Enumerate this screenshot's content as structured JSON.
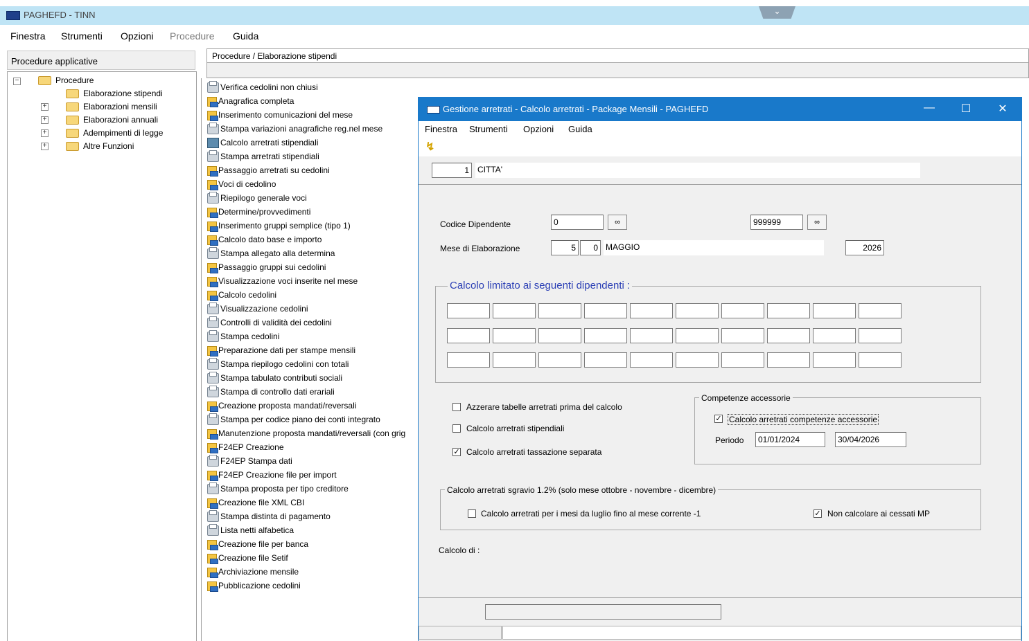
{
  "window": {
    "title": "PAGHEFD - TINN"
  },
  "menubar": [
    {
      "label": "Finestra"
    },
    {
      "label": "Strumenti"
    },
    {
      "label": "Opzioni"
    },
    {
      "label": "Procedure"
    },
    {
      "label": "Guida"
    }
  ],
  "left_panel": {
    "header": "Procedure applicative",
    "root": "Procedure",
    "items": [
      "Elaborazione stipendi",
      "Elaborazioni mensili",
      "Elaborazioni annuali",
      "Adempimenti di legge",
      "Altre Funzioni"
    ]
  },
  "center": {
    "breadcrumb": "Procedure / Elaborazione stipendi",
    "procedures": [
      {
        "label": "Verifica cedolini non chiusi",
        "icon": "print"
      },
      {
        "label": "Anagrafica completa",
        "icon": "doc"
      },
      {
        "label": "Inserimento comunicazioni del mese",
        "icon": "doc"
      },
      {
        "label": "Stampa variazioni anagrafiche reg.nel mese",
        "icon": "print"
      },
      {
        "label": "Calcolo arretrati stipendiali",
        "icon": "calc"
      },
      {
        "label": "Stampa arretrati stipendiali",
        "icon": "print"
      },
      {
        "label": "Passaggio arretrati su cedolini",
        "icon": "doc"
      },
      {
        "label": "Voci di cedolino",
        "icon": "doc"
      },
      {
        "label": "Riepilogo generale voci",
        "icon": "print"
      },
      {
        "label": "Determine/provvedimenti",
        "icon": "doc"
      },
      {
        "label": "Inserimento gruppi semplice (tipo 1)",
        "icon": "doc"
      },
      {
        "label": "Calcolo dato base e importo",
        "icon": "doc"
      },
      {
        "label": "Stampa allegato alla determina",
        "icon": "print"
      },
      {
        "label": "Passaggio gruppi sui cedolini",
        "icon": "doc"
      },
      {
        "label": "Visualizzazione voci inserite nel mese",
        "icon": "doc"
      },
      {
        "label": "Calcolo cedolini",
        "icon": "doc"
      },
      {
        "label": "Visualizzazione cedolini",
        "icon": "print"
      },
      {
        "label": "Controlli di validità dei cedolini",
        "icon": "print"
      },
      {
        "label": "Stampa cedolini",
        "icon": "print"
      },
      {
        "label": "Preparazione dati per stampe mensili",
        "icon": "doc"
      },
      {
        "label": "Stampa riepilogo cedolini con totali",
        "icon": "print"
      },
      {
        "label": "Stampa tabulato contributi sociali",
        "icon": "print"
      },
      {
        "label": "Stampa di controllo dati erariali",
        "icon": "print"
      },
      {
        "label": "Creazione proposta mandati/reversali",
        "icon": "doc"
      },
      {
        "label": "Stampa per codice piano dei conti integrato",
        "icon": "print"
      },
      {
        "label": "Manutenzione proposta mandati/reversali (con grig",
        "icon": "doc"
      },
      {
        "label": "F24EP Creazione",
        "icon": "doc"
      },
      {
        "label": "F24EP Stampa dati",
        "icon": "print"
      },
      {
        "label": "F24EP Creazione file per import",
        "icon": "doc"
      },
      {
        "label": "Stampa proposta per tipo creditore",
        "icon": "print"
      },
      {
        "label": "Creazione file XML CBI",
        "icon": "doc"
      },
      {
        "label": "Stampa distinta di pagamento",
        "icon": "print"
      },
      {
        "label": "Lista netti alfabetica",
        "icon": "print"
      },
      {
        "label": "Creazione file per banca",
        "icon": "doc"
      },
      {
        "label": "Creazione file Setif",
        "icon": "doc"
      },
      {
        "label": "Archiviazione mensile",
        "icon": "doc"
      },
      {
        "label": "Pubblicazione cedolini",
        "icon": "doc"
      }
    ]
  },
  "dialog": {
    "title": "Gestione arretrati - Calcolo arretrati  - Package Mensili - PAGHEFD",
    "menu": [
      "Finestra",
      "Strumenti",
      "Opzioni",
      "Guida"
    ],
    "ente_code": "1",
    "ente_name": "CITTA'",
    "codice_dipendente_label": "Codice Dipendente",
    "codice_da": "0",
    "codice_a": "999999",
    "mese_label": "Mese di Elaborazione",
    "mese_num": "5",
    "mese_sub": "0",
    "mese_nome": "MAGGIO",
    "anno": "2026",
    "calcolo_limitato_label": "Calcolo limitato ai seguenti dipendenti :",
    "cb_azzerare": {
      "label": "Azzerare tabelle arretrati prima del calcolo",
      "checked": false
    },
    "cb_stipendiali": {
      "label": "Calcolo arretrati stipendiali",
      "checked": false
    },
    "cb_tassazione": {
      "label": "Calcolo arretrati tassazione separata",
      "checked": true
    },
    "competenze": {
      "legend": "Competenze accessorie",
      "cb_label": "Calcolo arretrati competenze accessorie",
      "checked": true,
      "periodo_label": "Periodo",
      "periodo_da": "01/01/2024",
      "periodo_a": "30/04/2026"
    },
    "sgravio": {
      "legend": "Calcolo arretrati sgravio 1.2% (solo mese ottobre - novembre - dicembre)",
      "cb_mesi": {
        "label": "Calcolo arretrati per i mesi da luglio fino al mese corrente -1",
        "checked": false
      },
      "cb_cessati": {
        "label": "Non calcolare ai cessati MP",
        "checked": true
      }
    },
    "calcolo_di_label": "Calcolo di  :"
  }
}
